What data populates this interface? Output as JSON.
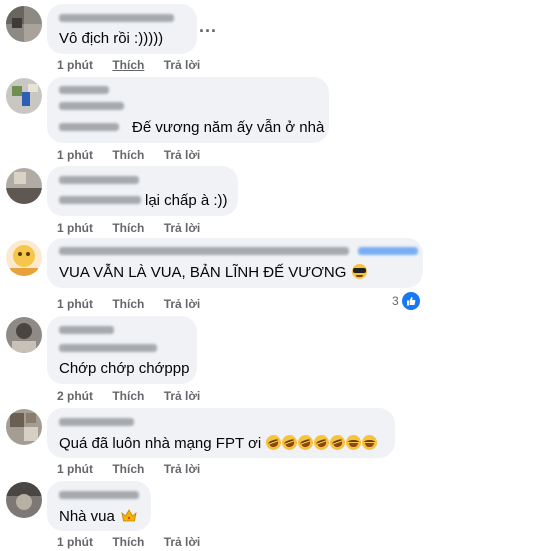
{
  "comments": [
    {
      "text": "Vô địch rồi :)))))",
      "time": "1 phút",
      "like": "Thích",
      "reply": "Trả lời",
      "more": "..."
    },
    {
      "text": "Đế vương năm ấy vẫn ở nhà",
      "time": "1 phút",
      "like": "Thích",
      "reply": "Trả lời"
    },
    {
      "text": "lại chấp à :))",
      "time": "1 phút",
      "like": "Thích",
      "reply": "Trả lời"
    },
    {
      "text": "VUA VẪN LÀ VUA, BẢN LĨNH ĐẾ VƯƠNG",
      "time": "1 phút",
      "like": "Thích",
      "reply": "Trả lời",
      "reaction_count": "3",
      "emoji": "sunglasses-emoji"
    },
    {
      "text": "Chớp chớp chớppp",
      "time": "2 phút",
      "like": "Thích",
      "reply": "Trả lời"
    },
    {
      "text": "Quá đã luôn nhà mạng FPT ơi",
      "time": "1 phút",
      "like": "Thích",
      "reply": "Trả lời",
      "emoji": "laughing-emoji"
    },
    {
      "text": "Nhà vua",
      "time": "1 phút",
      "like": "Thích",
      "reply": "Trả lời",
      "emoji": "crown-emoji"
    }
  ],
  "colors": {
    "bubble": "#f0f2f5",
    "meta": "#65676b",
    "like_blue": "#1877f2"
  }
}
